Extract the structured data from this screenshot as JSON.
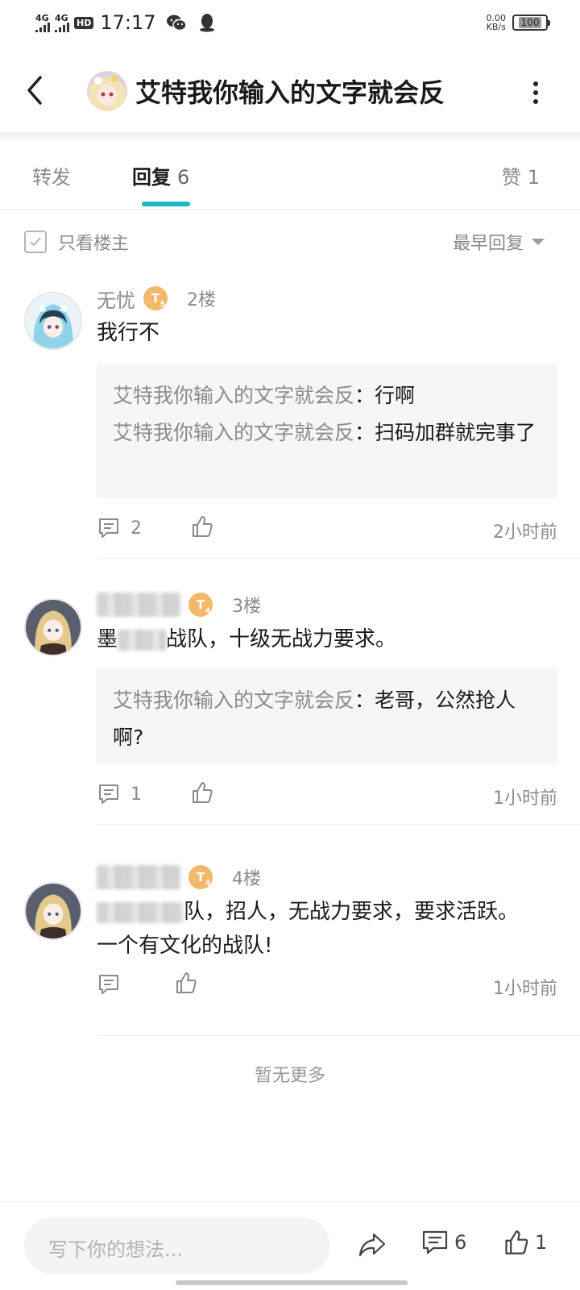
{
  "status_bar": {
    "sig1": "4G",
    "sig2": "4G",
    "hd": "HD",
    "time": "17:17",
    "speed_value": "0.00",
    "speed_unit": "KB/s",
    "battery": "100"
  },
  "header": {
    "title": "艾特我你输入的文字就会反"
  },
  "tabs": {
    "forward": "转发",
    "reply": "回复",
    "reply_count": "6",
    "like": "赞",
    "like_count": "1"
  },
  "filter": {
    "only_op": "只看楼主",
    "sort": "最早回复"
  },
  "posts": [
    {
      "user": "无忧",
      "badge": "T",
      "badge_level": "5",
      "floor": "2楼",
      "content": "我行不",
      "replies": [
        {
          "who": "艾特我你输入的文字就会反",
          "sep": "：",
          "text": "行啊"
        },
        {
          "who": "艾特我你输入的文字就会反",
          "sep": "：",
          "text": "扫码加群就完事了"
        }
      ],
      "comment_count": "2",
      "time": "2小时前"
    },
    {
      "user": "",
      "badge": "T",
      "badge_level": "4",
      "floor": "3楼",
      "content_prefix": "墨",
      "content_suffix": "战队，十级无战力要求。",
      "replies": [
        {
          "who": "艾特我你输入的文字就会反",
          "sep": "：",
          "text": "老哥，公然抢人啊?"
        }
      ],
      "comment_count": "1",
      "time": "1小时前"
    },
    {
      "user": "",
      "badge": "T",
      "badge_level": "4",
      "floor": "4楼",
      "content_suffix": "队，招人，无战力要求，要求活跃。",
      "content_line2": "一个有文化的战队!",
      "time": "1小时前"
    }
  ],
  "no_more": "暂无更多",
  "bottom": {
    "input_placeholder": "写下你的想法...",
    "comment_count": "6",
    "like_count": "1"
  },
  "colors": {
    "accent": "#1fb8c4",
    "badge": "#f2b86b",
    "muted_text": "#8a8a8a",
    "reply_bg": "#f6f6f6"
  }
}
